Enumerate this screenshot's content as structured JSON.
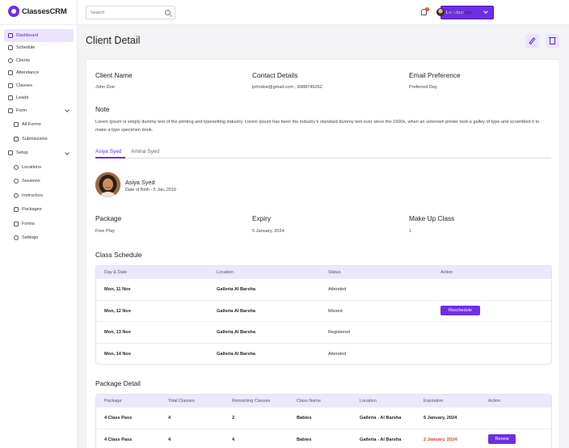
{
  "brand": {
    "name": "ClassesCRM"
  },
  "sidebar": {
    "items": [
      {
        "label": "Dashboard",
        "icon": "grid-icon",
        "active": true
      },
      {
        "label": "Schedule",
        "icon": "calendar-icon"
      },
      {
        "label": "Clients",
        "icon": "user-icon"
      },
      {
        "label": "Attendance",
        "icon": "attendance-icon"
      },
      {
        "label": "Classes",
        "icon": "book-icon"
      },
      {
        "label": "Leads",
        "icon": "leads-icon"
      },
      {
        "label": "Form",
        "icon": "form-icon",
        "expandable": true
      },
      {
        "label": "All Forms",
        "icon": "list-icon",
        "sub": true
      },
      {
        "label": "Submissions",
        "icon": "inbox-icon",
        "sub": true
      },
      {
        "label": "Setup",
        "icon": "setup-icon",
        "expandable": true
      },
      {
        "label": "Locations",
        "icon": "location-icon",
        "sub": true
      },
      {
        "label": "Sessions",
        "icon": "sessions-icon",
        "sub": true
      },
      {
        "label": "Instructors",
        "icon": "instructor-icon",
        "sub": true
      },
      {
        "label": "Packages",
        "icon": "package-icon",
        "sub": true
      },
      {
        "label": "Forms",
        "icon": "forms-icon",
        "sub": true
      },
      {
        "label": "Settings",
        "icon": "gear-icon",
        "sub": true
      }
    ]
  },
  "topbar": {
    "search_placeholder": "Search",
    "location_label": "Location",
    "notification_count": "2",
    "user_name": "Diane Fragge"
  },
  "page": {
    "title": "Client Detail"
  },
  "client": {
    "name_label": "Client Name",
    "name": "John Doe",
    "contact_label": "Contact Details",
    "contact": "johndoe@gmail.com , 6988745262",
    "email_pref_label": "Email Preference",
    "email_pref": "Preferred Day",
    "note_label": "Note",
    "note": "Lorem Ipsum is simply dummy text of the printing and typesetting industry. Lorem Ipsum has been the industry's standard dummy text ever since the 1500s, when an unknown printer took a galley of type and scrambled it to make a type specimen book."
  },
  "tabs": [
    {
      "label": "Asiya Syed",
      "active": true
    },
    {
      "label": "Amina Syed",
      "active": false
    }
  ],
  "child": {
    "name": "Asiya Syed",
    "dob": "Date of Birth - 5 Jan, 2019",
    "package_label": "Package",
    "package": "Free Play",
    "expiry_label": "Expiry",
    "expiry": "5 January, 2024",
    "makeup_label": "Make Up Class",
    "makeup": "1"
  },
  "schedule": {
    "title": "Class Schedule",
    "headers": [
      "Day & Date",
      "Location",
      "Status",
      "Action"
    ],
    "rows": [
      {
        "date": "Mon, 11 Nov",
        "location": "Galleria Al Barsha",
        "status": "Attended",
        "action": ""
      },
      {
        "date": "Mon, 12 Nov",
        "location": "Galleria Al Barsha",
        "status": "Missed",
        "action": "Reschedule"
      },
      {
        "date": "Mon, 13 Nov",
        "location": "Galleria Al Barsha",
        "status": "Registered",
        "action": ""
      },
      {
        "date": "Mon, 14 Nov",
        "location": "Galleria Al Barsha",
        "status": "Attended",
        "action": ""
      }
    ]
  },
  "packages": {
    "title": "Package Detail",
    "headers": [
      "Package",
      "Total Classes",
      "Remaining Classes",
      "Class Name",
      "Location",
      "Expiration",
      "Action"
    ],
    "rows": [
      {
        "package": "4 Class Pass",
        "total": "4",
        "remaining": "2",
        "class_name": "Babies",
        "location": "Galleria - Al Barsha",
        "expiration": "5 January, 2024",
        "expired": false,
        "action": ""
      },
      {
        "package": "4 Class Pass",
        "total": "4",
        "remaining": "4",
        "class_name": "Babies",
        "location": "Galleria - Al Barsha",
        "expiration": "2 January, 2024",
        "expired": true,
        "action": "Renew"
      }
    ]
  },
  "colors": {
    "accent": "#6f2ee6",
    "accent_light": "#ece3fc",
    "danger": "#e53935"
  }
}
